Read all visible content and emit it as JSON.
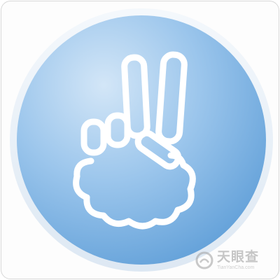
{
  "logo": {
    "icon": "victory-hand-icon",
    "colors": {
      "circle_light": "#c9e0f5",
      "circle_mid": "#8fbde8",
      "circle_dark": "#5f9fd8",
      "ring": "#eef4fa",
      "hand": "#ffffff"
    }
  },
  "watermark": {
    "icon": "tianyancha-logo-icon",
    "text": "天眼查",
    "subtext": "TianYanCha.com"
  }
}
